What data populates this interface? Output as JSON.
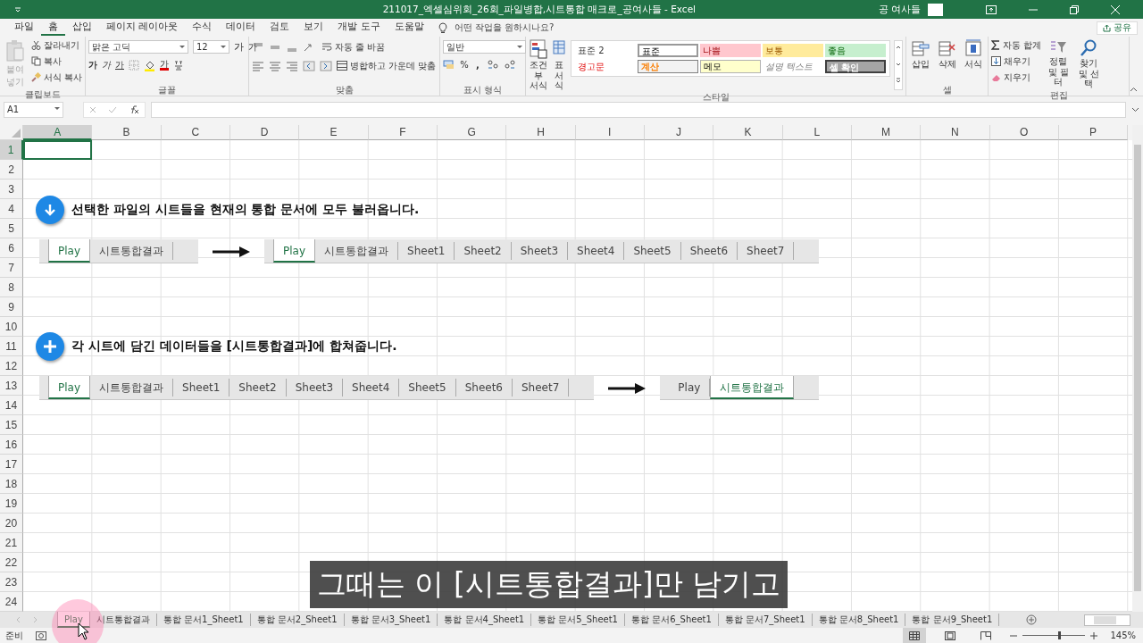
{
  "window": {
    "title": "211017_엑셀심위회_26회_파일병합,시트통합 매크로_공여사들  -  Excel",
    "user": "공 여사들"
  },
  "ribbon_tabs": [
    {
      "label": "파일",
      "selected": false
    },
    {
      "label": "홈",
      "selected": true
    },
    {
      "label": "삽입",
      "selected": false
    },
    {
      "label": "페이지 레이아웃",
      "selected": false
    },
    {
      "label": "수식",
      "selected": false
    },
    {
      "label": "데이터",
      "selected": false
    },
    {
      "label": "검토",
      "selected": false
    },
    {
      "label": "보기",
      "selected": false
    },
    {
      "label": "개발 도구",
      "selected": false
    },
    {
      "label": "도움말",
      "selected": false
    }
  ],
  "tell_me": "어떤 작업을 원하시나요?",
  "share": "공유",
  "ribbon": {
    "clipboard": {
      "label": "클립보드",
      "paste": "붙여넣기",
      "cut": "잘라내기",
      "copy": "복사",
      "format_painter": "서식 복사"
    },
    "font": {
      "label": "글꼴",
      "name": "맑은 고딕",
      "size": "12",
      "resize": [
        {
          "kind": "grow",
          "label": "가"
        },
        {
          "kind": "shrink",
          "label": "가"
        }
      ],
      "styles": [
        {
          "kind": "bold",
          "label": "가"
        },
        {
          "kind": "italic",
          "label": "가"
        },
        {
          "kind": "underline",
          "label": "가"
        }
      ],
      "font_color": "가"
    },
    "alignment": {
      "label": "맞춤",
      "wrap": "자동 줄 바꿈",
      "merge": "병합하고 가운데 맞춤"
    },
    "number": {
      "label": "표시 형식",
      "format": "일반",
      "percent": "%",
      "comma": ","
    },
    "styles": {
      "label": "스타일",
      "conditional": "조건부 서식",
      "table": "표 서식",
      "cells": [
        {
          "label": "표준 2",
          "kind": "plain"
        },
        {
          "label": "표준",
          "kind": "normal"
        },
        {
          "label": "나쁨",
          "kind": "bad"
        },
        {
          "label": "보통",
          "kind": "neutral"
        },
        {
          "label": "좋음",
          "kind": "good"
        },
        {
          "label": "경고문",
          "kind": "warning"
        },
        {
          "label": "계산",
          "kind": "calculation"
        },
        {
          "label": "메모",
          "kind": "note"
        },
        {
          "label": "설명 텍스트",
          "kind": "explanatory"
        },
        {
          "label": "셀 확인",
          "kind": "check"
        }
      ]
    },
    "cells": {
      "label": "셀",
      "insert": "삽입",
      "delete": "삭제",
      "format": "서식"
    },
    "editing": {
      "label": "편집",
      "autosum": "자동 합계",
      "fill": "채우기",
      "clear": "지우기",
      "sort": "정렬 및 필터",
      "find": "찾기 및 선택"
    }
  },
  "name_box": "A1",
  "columns": [
    {
      "label": "A",
      "selected": true
    },
    {
      "label": "B",
      "selected": false
    },
    {
      "label": "C",
      "selected": false
    },
    {
      "label": "D",
      "selected": false
    },
    {
      "label": "E",
      "selected": false
    },
    {
      "label": "F",
      "selected": false
    },
    {
      "label": "G",
      "selected": false
    },
    {
      "label": "H",
      "selected": false
    },
    {
      "label": "I",
      "selected": false
    },
    {
      "label": "J",
      "selected": false
    },
    {
      "label": "K",
      "selected": false
    },
    {
      "label": "L",
      "selected": false
    },
    {
      "label": "M",
      "selected": false
    },
    {
      "label": "N",
      "selected": false
    },
    {
      "label": "O",
      "selected": false
    },
    {
      "label": "P",
      "selected": false
    }
  ],
  "rows": [
    {
      "label": "1",
      "selected": true
    },
    {
      "label": "2",
      "selected": false
    },
    {
      "label": "3",
      "selected": false
    },
    {
      "label": "4",
      "selected": false
    },
    {
      "label": "5",
      "selected": false
    },
    {
      "label": "6",
      "selected": false
    },
    {
      "label": "7",
      "selected": false
    },
    {
      "label": "8",
      "selected": false
    },
    {
      "label": "9",
      "selected": false
    },
    {
      "label": "10",
      "selected": false
    },
    {
      "label": "11",
      "selected": false
    },
    {
      "label": "12",
      "selected": false
    },
    {
      "label": "13",
      "selected": false
    },
    {
      "label": "14",
      "selected": false
    },
    {
      "label": "15",
      "selected": false
    },
    {
      "label": "16",
      "selected": false
    },
    {
      "label": "17",
      "selected": false
    },
    {
      "label": "18",
      "selected": false
    },
    {
      "label": "19",
      "selected": false
    },
    {
      "label": "20",
      "selected": false
    },
    {
      "label": "21",
      "selected": false
    },
    {
      "label": "22",
      "selected": false
    },
    {
      "label": "23",
      "selected": false
    },
    {
      "label": "24",
      "selected": false
    }
  ],
  "steps": [
    {
      "kind": "download",
      "text": "선택한 파일의 시트들을 현재의 통합 문서에 모두 불러옵니다.",
      "before": [
        {
          "label": "Play",
          "selected": true
        },
        {
          "label": "시트통합결과",
          "selected": false
        }
      ],
      "after": [
        {
          "label": "Play",
          "selected": true
        },
        {
          "label": "시트통합결과",
          "selected": false
        },
        {
          "label": "Sheet1",
          "selected": false
        },
        {
          "label": "Sheet2",
          "selected": false
        },
        {
          "label": "Sheet3",
          "selected": false
        },
        {
          "label": "Sheet4",
          "selected": false
        },
        {
          "label": "Sheet5",
          "selected": false
        },
        {
          "label": "Sheet6",
          "selected": false
        },
        {
          "label": "Sheet7",
          "selected": false
        }
      ]
    },
    {
      "kind": "add",
      "text": "각 시트에 담긴 데이터들을 [시트통합결과]에 합쳐줍니다.",
      "before": [
        {
          "label": "Play",
          "selected": true
        },
        {
          "label": "시트통합결과",
          "selected": false
        },
        {
          "label": "Sheet1",
          "selected": false
        },
        {
          "label": "Sheet2",
          "selected": false
        },
        {
          "label": "Sheet3",
          "selected": false
        },
        {
          "label": "Sheet4",
          "selected": false
        },
        {
          "label": "Sheet5",
          "selected": false
        },
        {
          "label": "Sheet6",
          "selected": false
        },
        {
          "label": "Sheet7",
          "selected": false
        }
      ],
      "after": [
        {
          "label": "Play",
          "selected": false
        },
        {
          "label": "시트통합결과",
          "selected": true
        }
      ]
    }
  ],
  "caption": "그때는 이 [시트통합결과]만 남기고",
  "sheet_tabs": [
    {
      "label": "Play",
      "selected": true
    },
    {
      "label": "시트통합결과",
      "selected": false
    },
    {
      "label": "통합 문서1_Sheet1",
      "selected": false
    },
    {
      "label": "통합 문서2_Sheet1",
      "selected": false
    },
    {
      "label": "통합 문서3_Sheet1",
      "selected": false
    },
    {
      "label": "통합 문서4_Sheet1",
      "selected": false
    },
    {
      "label": "통합 문서5_Sheet1",
      "selected": false
    },
    {
      "label": "통합 문서6_Sheet1",
      "selected": false
    },
    {
      "label": "통합 문서7_Sheet1",
      "selected": false
    },
    {
      "label": "통합 문서8_Sheet1",
      "selected": false
    },
    {
      "label": "통합 문서9_Sheet1",
      "selected": false
    }
  ],
  "status_bar": {
    "status": "준비",
    "zoom": "145%",
    "zoom_slider": {
      "level": 0.57
    }
  }
}
